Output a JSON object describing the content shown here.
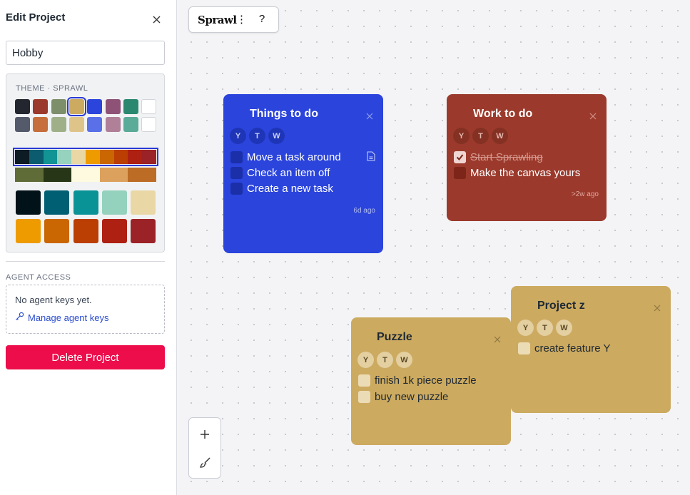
{
  "sidebar": {
    "title": "Edit Project",
    "project_name": "Hobby",
    "theme_label": "THEME · SPRAWL",
    "swatches_row1": [
      "#23262f",
      "#9b3a2c",
      "#7d8e6b",
      "#ccaa60",
      "#2b44dc",
      "#8e5276",
      "#2b8870",
      "#ffffff"
    ],
    "swatches_row2": [
      "#555a6b",
      "#c66e3c",
      "#9fb088",
      "#dfc48a",
      "#5a70e8",
      "#b07f98",
      "#5aab98",
      "#ffffff"
    ],
    "selected_swatch": "#ccaa60",
    "palettes": [
      [
        "#0d1b24",
        "#0a5c6e",
        "#129494",
        "#96d2bd",
        "#e9d8a6",
        "#ee9b00",
        "#ca6702",
        "#bb3e03",
        "#ae2012",
        "#9b2226"
      ],
      [
        "#606c38",
        "#283618",
        "#fefae0",
        "#dda15e",
        "#bc6c25"
      ]
    ],
    "big_swatches_row1": [
      "#021219",
      "#005f73",
      "#0a9396",
      "#94d2bd",
      "#e9d8a6"
    ],
    "big_swatches_row2": [
      "#ee9b00",
      "#ca6702",
      "#bb3e03",
      "#ae2012",
      "#9b2226"
    ],
    "agent_label": "AGENT ACCESS",
    "agent_empty": "No agent keys yet.",
    "agent_link": "Manage agent keys",
    "delete_label": "Delete Project"
  },
  "toolbar": {
    "brand": "Sprawl",
    "menu": "⋮",
    "help": "?"
  },
  "cards": [
    {
      "title": "Things to do",
      "color": "#2b44dc",
      "avatars": [
        "Y",
        "T",
        "W"
      ],
      "tasks": [
        {
          "text": "Move a task around",
          "done": false
        },
        {
          "text": "Check an item off",
          "done": false
        },
        {
          "text": "Create a new task",
          "done": false
        }
      ],
      "timestamp": "6d ago"
    },
    {
      "title": "Work to do",
      "color": "#9b3a2c",
      "avatars": [
        "Y",
        "T",
        "W"
      ],
      "tasks": [
        {
          "text": "Start Sprawling",
          "done": true
        },
        {
          "text": "Make the canvas yours",
          "done": false
        }
      ],
      "timestamp": ">2w ago"
    },
    {
      "title": "Puzzle",
      "color": "#ccaa60",
      "avatars": [
        "Y",
        "T",
        "W"
      ],
      "tasks": [
        {
          "text": "finish 1k piece puzzle",
          "done": false
        },
        {
          "text": "buy new puzzle",
          "done": false
        }
      ],
      "timestamp": ""
    },
    {
      "title": "Project z",
      "color": "#ccaa60",
      "avatars": [
        "Y",
        "T",
        "W"
      ],
      "tasks": [
        {
          "text": "create feature Y",
          "done": false
        }
      ],
      "timestamp": ""
    }
  ],
  "tools": {
    "add_icon": "plus-icon",
    "brush_icon": "brush-icon"
  }
}
